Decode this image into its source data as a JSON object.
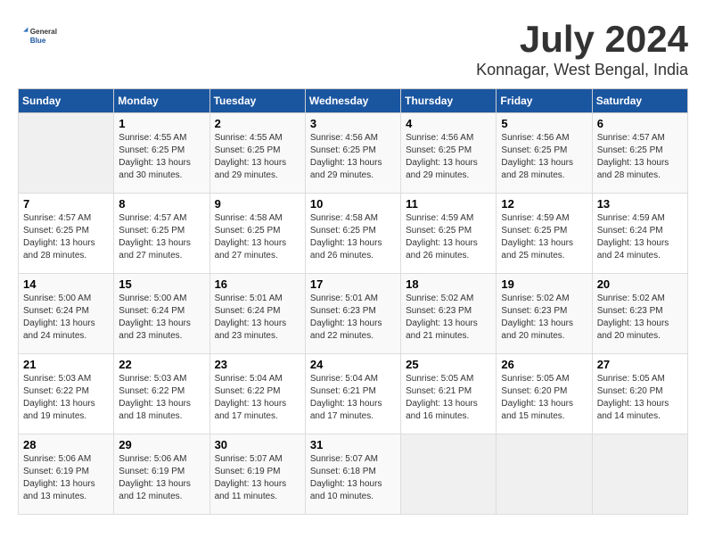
{
  "logo": {
    "general": "General",
    "blue": "Blue"
  },
  "title": "July 2024",
  "subtitle": "Konnagar, West Bengal, India",
  "days_of_week": [
    "Sunday",
    "Monday",
    "Tuesday",
    "Wednesday",
    "Thursday",
    "Friday",
    "Saturday"
  ],
  "weeks": [
    [
      {
        "day": "",
        "info": ""
      },
      {
        "day": "1",
        "info": "Sunrise: 4:55 AM\nSunset: 6:25 PM\nDaylight: 13 hours\nand 30 minutes."
      },
      {
        "day": "2",
        "info": "Sunrise: 4:55 AM\nSunset: 6:25 PM\nDaylight: 13 hours\nand 29 minutes."
      },
      {
        "day": "3",
        "info": "Sunrise: 4:56 AM\nSunset: 6:25 PM\nDaylight: 13 hours\nand 29 minutes."
      },
      {
        "day": "4",
        "info": "Sunrise: 4:56 AM\nSunset: 6:25 PM\nDaylight: 13 hours\nand 29 minutes."
      },
      {
        "day": "5",
        "info": "Sunrise: 4:56 AM\nSunset: 6:25 PM\nDaylight: 13 hours\nand 28 minutes."
      },
      {
        "day": "6",
        "info": "Sunrise: 4:57 AM\nSunset: 6:25 PM\nDaylight: 13 hours\nand 28 minutes."
      }
    ],
    [
      {
        "day": "7",
        "info": "Sunrise: 4:57 AM\nSunset: 6:25 PM\nDaylight: 13 hours\nand 28 minutes."
      },
      {
        "day": "8",
        "info": "Sunrise: 4:57 AM\nSunset: 6:25 PM\nDaylight: 13 hours\nand 27 minutes."
      },
      {
        "day": "9",
        "info": "Sunrise: 4:58 AM\nSunset: 6:25 PM\nDaylight: 13 hours\nand 27 minutes."
      },
      {
        "day": "10",
        "info": "Sunrise: 4:58 AM\nSunset: 6:25 PM\nDaylight: 13 hours\nand 26 minutes."
      },
      {
        "day": "11",
        "info": "Sunrise: 4:59 AM\nSunset: 6:25 PM\nDaylight: 13 hours\nand 26 minutes."
      },
      {
        "day": "12",
        "info": "Sunrise: 4:59 AM\nSunset: 6:25 PM\nDaylight: 13 hours\nand 25 minutes."
      },
      {
        "day": "13",
        "info": "Sunrise: 4:59 AM\nSunset: 6:24 PM\nDaylight: 13 hours\nand 24 minutes."
      }
    ],
    [
      {
        "day": "14",
        "info": "Sunrise: 5:00 AM\nSunset: 6:24 PM\nDaylight: 13 hours\nand 24 minutes."
      },
      {
        "day": "15",
        "info": "Sunrise: 5:00 AM\nSunset: 6:24 PM\nDaylight: 13 hours\nand 23 minutes."
      },
      {
        "day": "16",
        "info": "Sunrise: 5:01 AM\nSunset: 6:24 PM\nDaylight: 13 hours\nand 23 minutes."
      },
      {
        "day": "17",
        "info": "Sunrise: 5:01 AM\nSunset: 6:23 PM\nDaylight: 13 hours\nand 22 minutes."
      },
      {
        "day": "18",
        "info": "Sunrise: 5:02 AM\nSunset: 6:23 PM\nDaylight: 13 hours\nand 21 minutes."
      },
      {
        "day": "19",
        "info": "Sunrise: 5:02 AM\nSunset: 6:23 PM\nDaylight: 13 hours\nand 20 minutes."
      },
      {
        "day": "20",
        "info": "Sunrise: 5:02 AM\nSunset: 6:23 PM\nDaylight: 13 hours\nand 20 minutes."
      }
    ],
    [
      {
        "day": "21",
        "info": "Sunrise: 5:03 AM\nSunset: 6:22 PM\nDaylight: 13 hours\nand 19 minutes."
      },
      {
        "day": "22",
        "info": "Sunrise: 5:03 AM\nSunset: 6:22 PM\nDaylight: 13 hours\nand 18 minutes."
      },
      {
        "day": "23",
        "info": "Sunrise: 5:04 AM\nSunset: 6:22 PM\nDaylight: 13 hours\nand 17 minutes."
      },
      {
        "day": "24",
        "info": "Sunrise: 5:04 AM\nSunset: 6:21 PM\nDaylight: 13 hours\nand 17 minutes."
      },
      {
        "day": "25",
        "info": "Sunrise: 5:05 AM\nSunset: 6:21 PM\nDaylight: 13 hours\nand 16 minutes."
      },
      {
        "day": "26",
        "info": "Sunrise: 5:05 AM\nSunset: 6:20 PM\nDaylight: 13 hours\nand 15 minutes."
      },
      {
        "day": "27",
        "info": "Sunrise: 5:05 AM\nSunset: 6:20 PM\nDaylight: 13 hours\nand 14 minutes."
      }
    ],
    [
      {
        "day": "28",
        "info": "Sunrise: 5:06 AM\nSunset: 6:19 PM\nDaylight: 13 hours\nand 13 minutes."
      },
      {
        "day": "29",
        "info": "Sunrise: 5:06 AM\nSunset: 6:19 PM\nDaylight: 13 hours\nand 12 minutes."
      },
      {
        "day": "30",
        "info": "Sunrise: 5:07 AM\nSunset: 6:19 PM\nDaylight: 13 hours\nand 11 minutes."
      },
      {
        "day": "31",
        "info": "Sunrise: 5:07 AM\nSunset: 6:18 PM\nDaylight: 13 hours\nand 10 minutes."
      },
      {
        "day": "",
        "info": ""
      },
      {
        "day": "",
        "info": ""
      },
      {
        "day": "",
        "info": ""
      }
    ]
  ]
}
